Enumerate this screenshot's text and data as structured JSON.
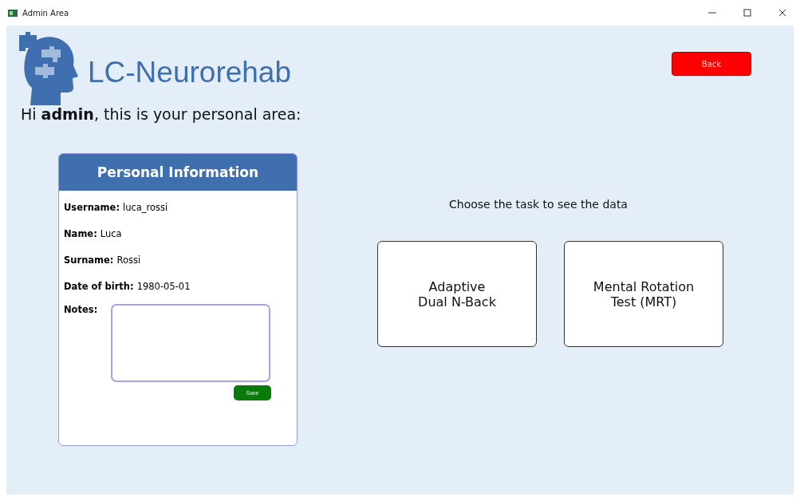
{
  "window": {
    "title": "Admin Area"
  },
  "app": {
    "name": "LC-Neurorehab"
  },
  "back_button": "Back",
  "greeting": "Hi **admin**, this is your personal area:",
  "personal_information": {
    "title": "Personal Information",
    "fields": [
      {
        "label": "Username:",
        "value": "luca_rossi"
      },
      {
        "label": "Name:",
        "value": "Luca"
      },
      {
        "label": "Surname:",
        "value": "Rossi"
      },
      {
        "label": "Date of birth:",
        "value": "1980-05-01"
      }
    ],
    "notes": {
      "label": "Notes:"
    },
    "save_button": "Save"
  },
  "tasks": {
    "prompt": "Choose the task to see the data",
    "buttons": [
      "Adaptive\nDual N-Back",
      "Mental Rotation\nTest (MRT)"
    ]
  }
}
